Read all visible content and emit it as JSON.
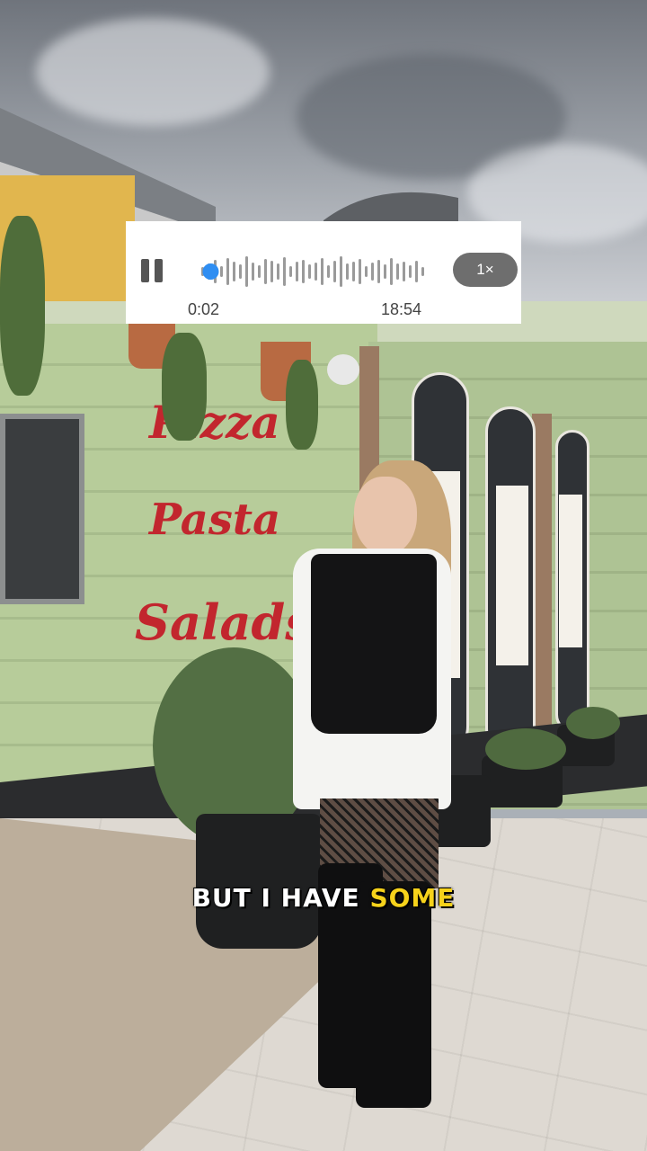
{
  "player": {
    "elapsed": "0:02",
    "duration": "18:54",
    "speed": "1×",
    "progress": 0.002,
    "icons": {
      "play_state": "pause-icon",
      "playhead": "playhead-dot"
    },
    "colors": {
      "accent": "#2f8ef2",
      "wave": "#9a9a9a",
      "speed_bg": "#6e6e6e"
    }
  },
  "caption": {
    "text": "BUT I HAVE",
    "highlight": "SOME",
    "colors": {
      "text": "#ffffff",
      "highlight": "#f6d21b"
    }
  },
  "background_signs": [
    "Pizza",
    "Pasta",
    "Salads"
  ]
}
